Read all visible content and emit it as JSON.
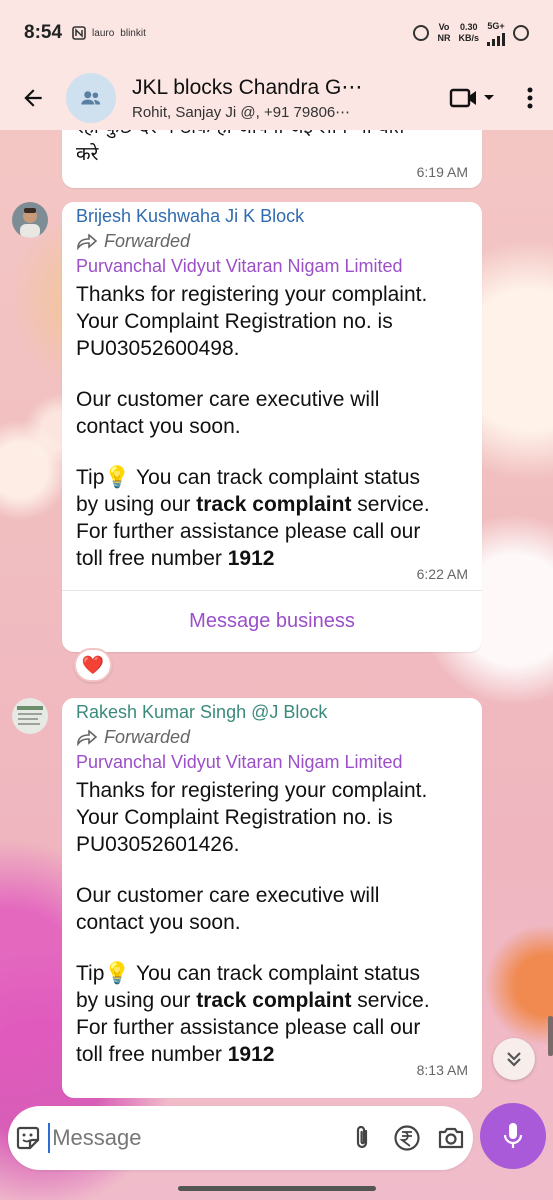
{
  "status_bar": {
    "time": "8:54",
    "apps": [
      "lauro",
      "blinkit"
    ],
    "net_top": "Vo",
    "net_bottom": "NR",
    "speed_value": "0.30",
    "speed_unit": "KB/s",
    "network_type": "5G+"
  },
  "header": {
    "title": "JKL blocks Chandra G⋯",
    "subtitle": "Rohit, Sanjay Ji @, +91 79806⋯"
  },
  "messages": [
    {
      "partial_text_line1": "रहा कुछ देर में ठीक हो जायगा जेई लोग भी बात",
      "partial_text_line2": "करे",
      "time": "6:19 AM"
    },
    {
      "sender": "Brijesh Kushwaha Ji K Block",
      "sender_color": "#2f6bb0",
      "forwarded_label": "Forwarded",
      "business": "Purvanchal Vidyut Vitaran Nigam Limited",
      "line1": "Thanks for registering your complaint.",
      "line2": "Your Complaint Registration no. is",
      "line3": "PU03052600498.",
      "line4": "Our customer care executive will",
      "line5": "contact you soon.",
      "tip_prefix": "Tip💡 You can track complaint status",
      "tip_by": "by using our ",
      "tip_bold": "track complaint",
      "tip_after": " service.",
      "tip_line3": "For further assistance please call our",
      "tip_toll": "toll free number ",
      "tip_toll_bold": "1912",
      "time": "6:22 AM",
      "action_label": "Message business",
      "reaction": "❤️"
    },
    {
      "sender": "Rakesh Kumar Singh @J Block",
      "sender_color": "#3a8a7c",
      "forwarded_label": "Forwarded",
      "business": "Purvanchal Vidyut Vitaran Nigam Limited",
      "line1": "Thanks for registering your complaint.",
      "line2": "Your Complaint Registration no. is",
      "line3": "PU03052601426.",
      "line4": "Our customer care executive will",
      "line5": "contact you soon.",
      "tip_prefix": "Tip💡 You can track complaint status",
      "tip_by": "by using our ",
      "tip_bold": "track complaint",
      "tip_after": " service.",
      "tip_line3": "For further assistance please call our",
      "tip_toll": "toll free number ",
      "tip_toll_bold": "1912",
      "time": "8:13 AM"
    }
  ],
  "composer": {
    "placeholder": "Message"
  },
  "colors": {
    "accent": "#a85ad8",
    "business_name": "#9b4fc9",
    "header_bg": "#fbe6e3"
  },
  "icons": [
    "back-arrow-icon",
    "group-icon",
    "video-call-icon",
    "more-vert-icon",
    "sticker-icon",
    "attach-icon",
    "rupee-icon",
    "camera-icon",
    "mic-icon",
    "double-chevron-down-icon",
    "forwarded-icon"
  ]
}
